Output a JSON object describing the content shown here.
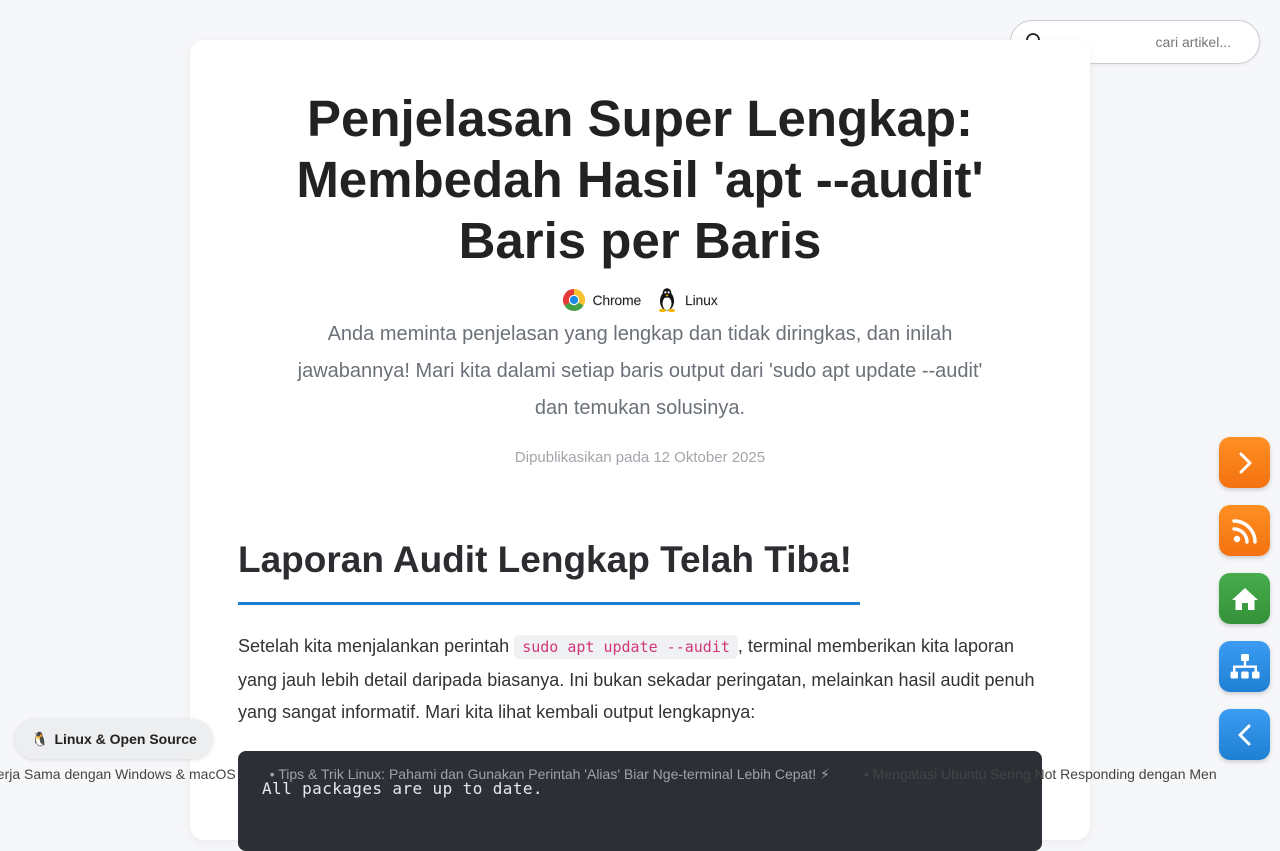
{
  "search": {
    "placeholder": "cari artikel..."
  },
  "article": {
    "title": "Penjelasan Super Lengkap: Membedah Hasil 'apt --audit' Baris per Baris",
    "tags": [
      {
        "label": "Chrome",
        "icon": "chrome-icon"
      },
      {
        "label": "Linux",
        "icon": "tux-icon"
      }
    ],
    "subtitle": "Anda meminta penjelasan yang lengkap dan tidak diringkas, dan inilah jawabannya! Mari kita dalami setiap baris output dari 'sudo apt update --audit' dan temukan solusinya.",
    "published": "Dipublikasikan pada 12 Oktober 2025",
    "section_heading": "Laporan Audit Lengkap Telah Tiba!",
    "para_before_code": "Setelah kita menjalankan perintah ",
    "inline_code": "sudo apt update --audit",
    "para_after_code": ", terminal memberikan kita laporan yang jauh lebih detail daripada biasanya. Ini bukan sekadar peringatan, melainkan hasil audit penuh yang sangat informatif. Mari kita lihat kembali output lengkapnya:",
    "code_line": "All packages are up to date."
  },
  "badge": {
    "emoji": "🐧",
    "label": "Linux & Open Source"
  },
  "ticker": {
    "items": [
      "ekerja Sama dengan Windows & macOS",
      "• Tips & Trik Linux: Pahami dan Gunakan Perintah 'Alias' Biar Nge-terminal Lebih Cepat! ⚡",
      "• Mengatasi Ubuntu Sering Not Responding dengan Men"
    ]
  },
  "fabs": [
    {
      "name": "next-button",
      "icon": "chevron-right-icon",
      "color": "#f47211"
    },
    {
      "name": "rss-button",
      "icon": "rss-icon",
      "color": "#f47211"
    },
    {
      "name": "home-button",
      "icon": "home-icon",
      "color": "#35913a"
    },
    {
      "name": "sitemap-button",
      "icon": "sitemap-icon",
      "color": "#1f7fd3"
    },
    {
      "name": "previous-button",
      "icon": "chevron-left-icon",
      "color": "#1f7fd3"
    }
  ]
}
